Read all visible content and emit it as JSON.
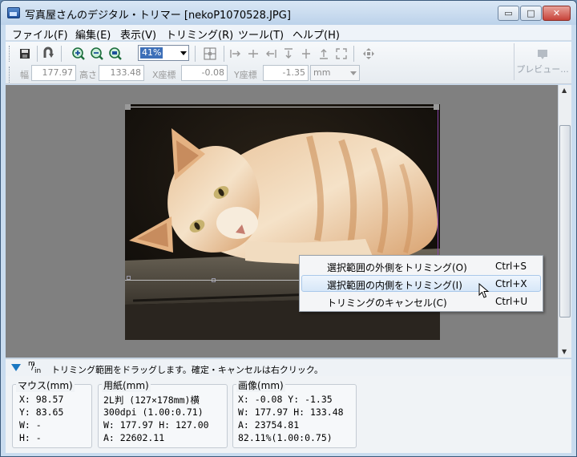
{
  "window": {
    "title": "写真屋さんのデジタル・トリマー [nekoP1070528.JPG]",
    "min_label": "▭",
    "max_label": "□",
    "close_label": "✕"
  },
  "menu": [
    {
      "label": "ファイル(F)"
    },
    {
      "label": "編集(E)"
    },
    {
      "label": "表示(V)"
    },
    {
      "label": "トリミング(R)"
    },
    {
      "label": "ツール(T)"
    },
    {
      "label": "ヘルプ(H)"
    }
  ],
  "toolbar": {
    "zoom_value": "41%",
    "preview_label": "プレビュー..."
  },
  "fields": {
    "width_label": "幅",
    "width_value": "177.97",
    "height_label": "高さ",
    "height_value": "133.48",
    "x_label": "X座標",
    "x_value": "-0.08",
    "y_label": "Y座標",
    "y_value": "-1.35",
    "unit": "mm"
  },
  "context_menu": [
    {
      "label": "選択範囲の外側をトリミング(O)",
      "shortcut": "Ctrl+S"
    },
    {
      "label": "選択範囲の内側をトリミング(I)",
      "shortcut": "Ctrl+X"
    },
    {
      "label": "トリミングのキャンセル(C)",
      "shortcut": "Ctrl+U"
    }
  ],
  "status": {
    "unit_symbol_top": "m",
    "unit_symbol_bottom": "in",
    "message": "トリミング範囲をドラッグします。確定・キャンセルは右クリック。"
  },
  "info": {
    "mouse": {
      "title": "マウス(mm)",
      "lines": [
        "X:    98.57",
        "Y:    83.65",
        "W:        -",
        "H:        -"
      ]
    },
    "paper": {
      "title": "用紙(mm)",
      "lines": [
        "2L判 (127×178mm)横",
        "300dpi (1.00:0.71)",
        "W: 177.97  H: 127.00",
        "A: 22602.11"
      ]
    },
    "image": {
      "title": "画像(mm)",
      "lines": [
        "X:  -0.08 Y:  -1.35",
        "W: 177.97 H: 133.48",
        "A: 23754.81",
        "82.11%(1.00:0.75)"
      ]
    }
  },
  "colors": {
    "title_gradient_top": "#d9e7f5",
    "canvas_bg": "#808080",
    "highlight": "#d7e7f8"
  }
}
